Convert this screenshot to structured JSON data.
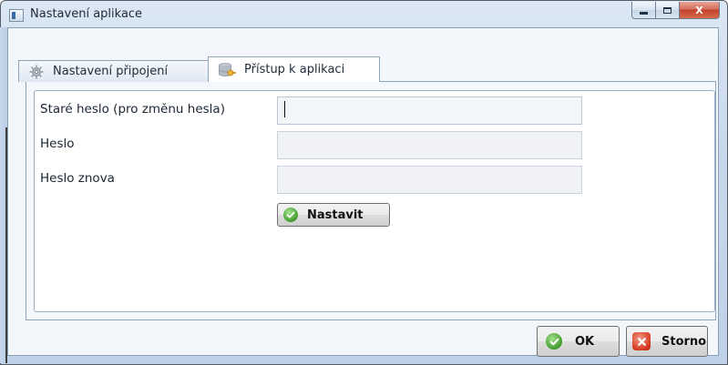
{
  "window": {
    "title": "Nastavení aplikace",
    "icon": "app-window-icon",
    "caption_buttons": {
      "minimize_icon": "minimize-icon",
      "maximize_icon": "maximize-icon",
      "close_label": "X"
    }
  },
  "tabs": [
    {
      "label": "Nastavení připojení",
      "icon": "gear-icon",
      "active": false
    },
    {
      "label": "Přístup k aplikaci",
      "icon": "database-key-icon",
      "active": true
    }
  ],
  "form": {
    "old_password": {
      "label": "Staré heslo  (pro změnu hesla)",
      "value": ""
    },
    "password": {
      "label": "Heslo",
      "value": ""
    },
    "password_again": {
      "label": "Heslo znova",
      "value": ""
    },
    "set_button": {
      "label": "Nastavit",
      "icon": "check-circle-icon"
    }
  },
  "footer": {
    "ok_button": {
      "label": "OK",
      "icon": "check-circle-icon"
    },
    "cancel_button": {
      "label": "Storno",
      "icon": "cancel-x-icon"
    }
  },
  "colors": {
    "accent_green": "#3e9a2b",
    "accent_red": "#d63a22",
    "frame_blue": "#c9d9ec"
  }
}
